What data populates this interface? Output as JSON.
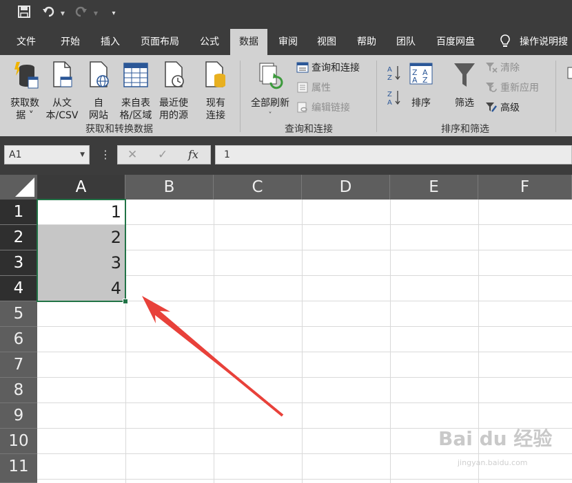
{
  "qat": {
    "save_icon": "save-icon",
    "undo_icon": "undo-icon",
    "redo_icon": "redo-icon",
    "customize_icon": "customize-qat-icon"
  },
  "tabs": [
    {
      "label": "文件"
    },
    {
      "label": "开始"
    },
    {
      "label": "插入"
    },
    {
      "label": "页面布局"
    },
    {
      "label": "公式"
    },
    {
      "label": "数据",
      "active": true
    },
    {
      "label": "审阅"
    },
    {
      "label": "视图"
    },
    {
      "label": "帮助"
    },
    {
      "label": "团队"
    },
    {
      "label": "百度网盘"
    }
  ],
  "tell_me": "操作说明搜",
  "ribbon": {
    "get_transform": {
      "buttons": [
        {
          "line1": "获取数",
          "line2": "据 ˅",
          "icon": "database-icon"
        },
        {
          "line1": "从文",
          "line2": "本/CSV",
          "icon": "text-file-icon"
        },
        {
          "line1": "自",
          "line2": "网站",
          "icon": "web-icon"
        },
        {
          "line1": "来自表",
          "line2": "格/区域",
          "icon": "table-icon"
        },
        {
          "line1": "最近使",
          "line2": "用的源",
          "icon": "recent-sources-icon"
        },
        {
          "line1": "现有",
          "line2": "连接",
          "icon": "existing-connections-icon"
        }
      ],
      "label": "获取和转换数据"
    },
    "queries": {
      "refresh_all": "全部刷新",
      "refresh_arrow": "˅",
      "queries_connections": "查询和连接",
      "properties": "属性",
      "edit_links": "编辑链接",
      "label": "查询和连接"
    },
    "sort_filter": {
      "sort": "排序",
      "filter": "筛选",
      "clear": "清除",
      "reapply": "重新应用",
      "advanced": "高级",
      "label": "排序和筛选"
    }
  },
  "formula_bar": {
    "name_box": "A1",
    "cancel": "✕",
    "enter": "✓",
    "fx": "fx",
    "value": "1"
  },
  "grid": {
    "columns": [
      "A",
      "B",
      "C",
      "D",
      "E",
      "F"
    ],
    "rows": [
      "1",
      "2",
      "3",
      "4",
      "5",
      "6",
      "7",
      "8",
      "9",
      "10",
      "11"
    ],
    "col_a_values": [
      "1",
      "2",
      "3",
      "4"
    ]
  },
  "watermark": {
    "logo": "Bai du 经验",
    "url": "jingyan.baidu.com"
  },
  "colors": {
    "selection": "#217346",
    "arrow": "#e8413a",
    "ribbon": "#d2d2d2",
    "chrome": "#3c3c3c"
  }
}
